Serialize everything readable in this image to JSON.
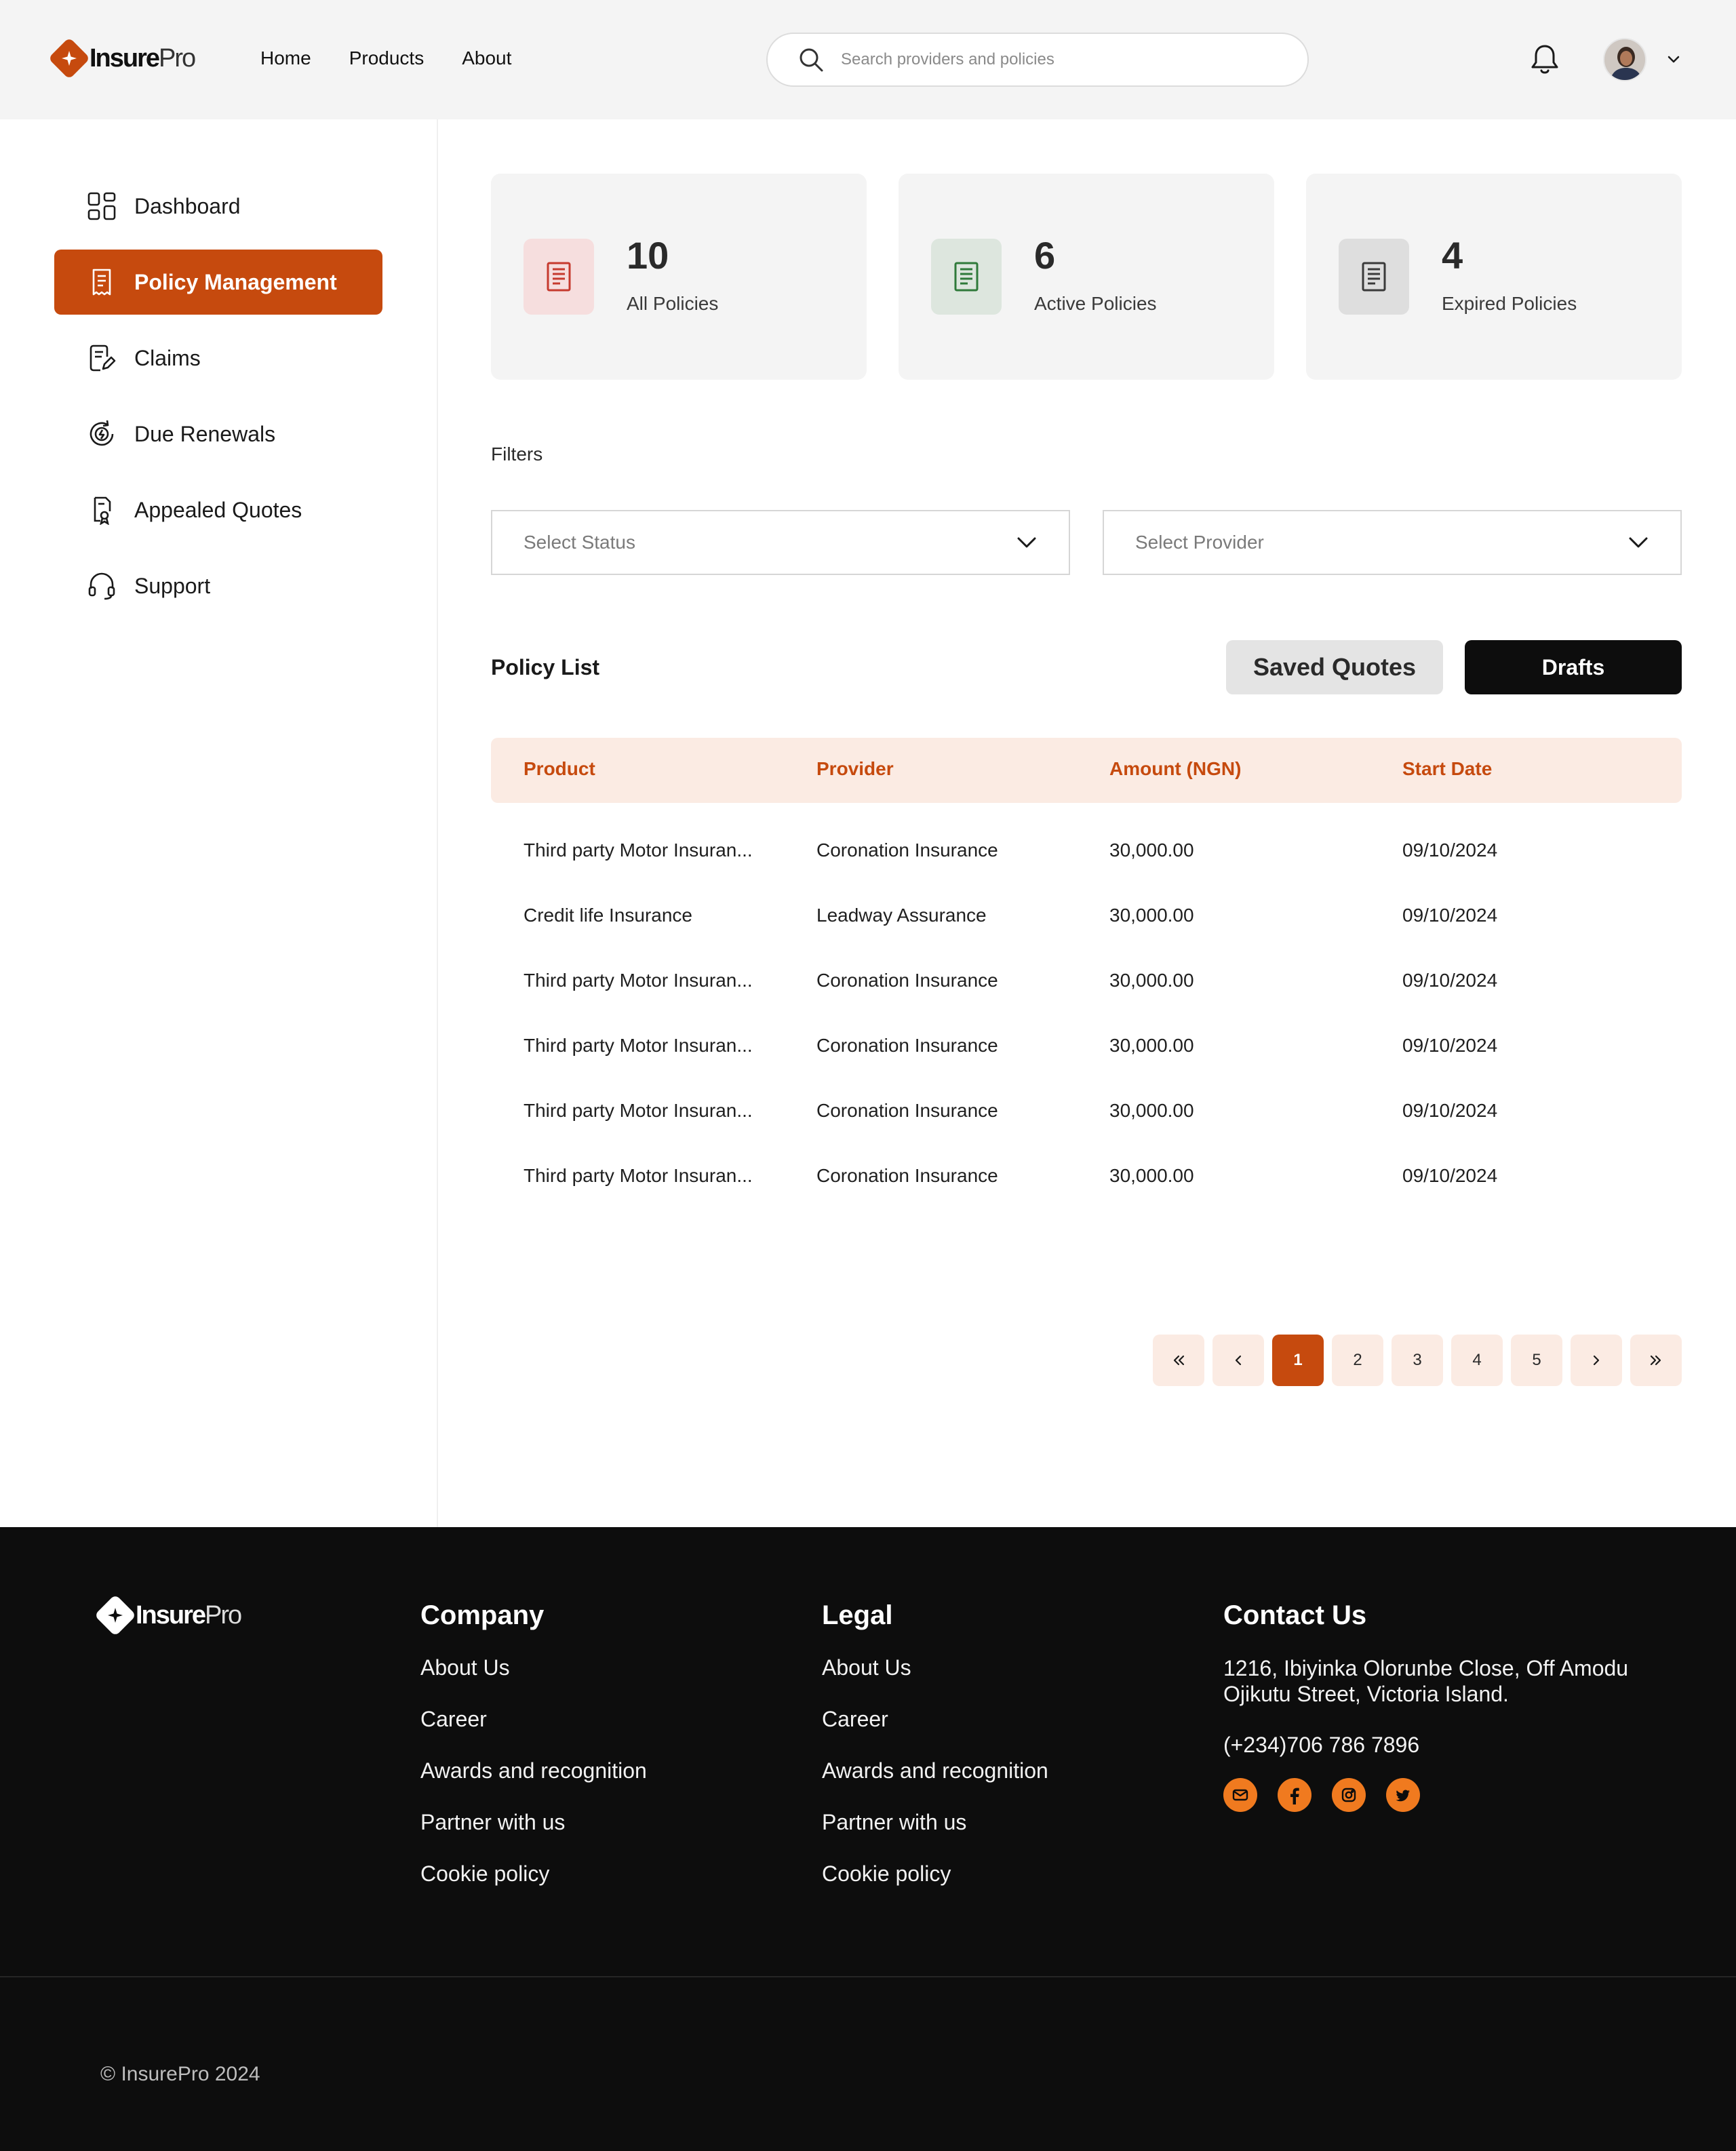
{
  "brand": {
    "bold": "Insure",
    "light": "Pro"
  },
  "colors": {
    "accent": "#c64a0e",
    "accent_light": "#fbebe3",
    "footer_bg": "#0d0d0d",
    "social": "#f07a1f"
  },
  "header": {
    "nav": [
      "Home",
      "Products",
      "About"
    ],
    "search_placeholder": "Search providers and policies"
  },
  "sidebar": {
    "items": [
      {
        "label": "Dashboard",
        "icon": "grid-icon"
      },
      {
        "label": "Policy Management",
        "icon": "document-icon",
        "active": true
      },
      {
        "label": "Claims",
        "icon": "document-edit-icon"
      },
      {
        "label": "Due Renewals",
        "icon": "renew-icon"
      },
      {
        "label": "Appealed Quotes",
        "icon": "quote-icon"
      },
      {
        "label": "Support",
        "icon": "headset-icon"
      }
    ]
  },
  "stats": [
    {
      "value": "10",
      "label": "All Policies",
      "tone": "red"
    },
    {
      "value": "6",
      "label": "Active Policies",
      "tone": "green"
    },
    {
      "value": "4",
      "label": "Expired Policies",
      "tone": "gray"
    }
  ],
  "filters": {
    "title": "Filters",
    "status_placeholder": "Select Status",
    "provider_placeholder": "Select Provider"
  },
  "policy_list": {
    "title": "Policy List",
    "saved_quotes_label": "Saved Quotes",
    "drafts_label": "Drafts",
    "columns": [
      "Product",
      "Provider",
      "Amount (NGN)",
      "Start Date"
    ],
    "rows": [
      [
        "Third party Motor Insuran...",
        "Coronation Insurance",
        "30,000.00",
        "09/10/2024"
      ],
      [
        "Credit life Insurance",
        "Leadway Assurance",
        "30,000.00",
        "09/10/2024"
      ],
      [
        "Third party Motor Insuran...",
        "Coronation Insurance",
        "30,000.00",
        "09/10/2024"
      ],
      [
        "Third party Motor Insuran...",
        "Coronation Insurance",
        "30,000.00",
        "09/10/2024"
      ],
      [
        "Third party Motor Insuran...",
        "Coronation Insurance",
        "30,000.00",
        "09/10/2024"
      ],
      [
        "Third party Motor Insuran...",
        "Coronation Insurance",
        "30,000.00",
        "09/10/2024"
      ]
    ]
  },
  "pagination": {
    "pages": [
      "1",
      "2",
      "3",
      "4",
      "5"
    ],
    "current": "1"
  },
  "footer": {
    "company": {
      "title": "Company",
      "links": [
        "About Us",
        "Career",
        "Awards and recognition",
        "Partner with us",
        "Cookie policy"
      ]
    },
    "legal": {
      "title": "Legal",
      "links": [
        "About Us",
        "Career",
        "Awards and recognition",
        "Partner with us",
        "Cookie policy"
      ]
    },
    "contact": {
      "title": "Contact Us",
      "address": "1216, Ibiyinka Olorunbe Close, Off Amodu Ojikutu Street, Victoria Island.",
      "phone": "(+234)706 786 7896",
      "socials": [
        "mail-icon",
        "facebook-icon",
        "instagram-icon",
        "twitter-icon"
      ]
    },
    "copyright": "© InsurePro 2024"
  }
}
